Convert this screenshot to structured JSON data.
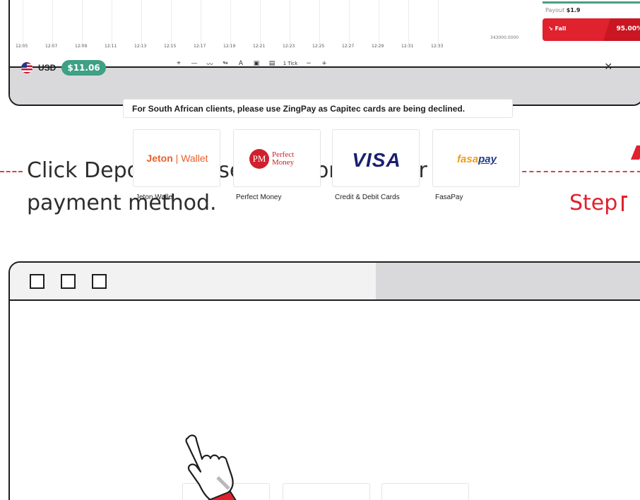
{
  "trading": {
    "time_ticks": [
      "12:05",
      "12:07",
      "12:09",
      "12:11",
      "12:13",
      "12:15",
      "12:17",
      "12:19",
      "12:21",
      "12:23",
      "12:25",
      "12:27",
      "12:29",
      "12:31",
      "12:33"
    ],
    "price_label": "343000.0000",
    "toolbar": {
      "items": [
        "crosshair-icon",
        "line-icon",
        "trend-icon",
        "arrow-icon",
        "text-icon",
        "note-icon",
        "file-icon"
      ],
      "tick_label": "1 Tick",
      "minus": "−",
      "plus": "+"
    },
    "payout_label": "Payout",
    "payout_value": "$1.9",
    "fall_label": "Fall",
    "fall_percent": "95.00%"
  },
  "instruction": {
    "text": "Click Deposit and select Jeton as your payment method.",
    "step": "Step"
  },
  "deposit": {
    "currency": "USD",
    "balance": "$11.06",
    "close": "×",
    "notice": "For South African clients, please use ZingPay as Capitec cards are being declined.",
    "methods": [
      {
        "label": "Jeton Wallet",
        "logo_a": "Jeton",
        "logo_b": "Wallet"
      },
      {
        "label": "Perfect Money",
        "logo_mark": "PM",
        "logo_a": "Perfect",
        "logo_b": "Money"
      },
      {
        "label": "Credit & Debit Cards",
        "logo_a": "VISA"
      },
      {
        "label": "FasaPay",
        "logo_a": "fasa",
        "logo_b": "pay"
      }
    ]
  },
  "colors": {
    "accent_red": "#e0212e",
    "balance_green": "#3ea084",
    "jeton_orange": "#e8612b",
    "visa_blue": "#1a1f71"
  }
}
